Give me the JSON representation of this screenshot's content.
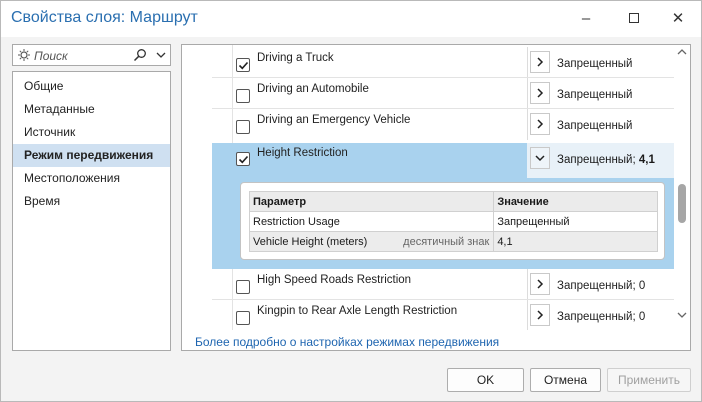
{
  "window": {
    "title": "Свойства слоя: Маршрут",
    "minimize": "–",
    "close": "✕"
  },
  "search": {
    "placeholder": "Поиск"
  },
  "sidebar": {
    "items": [
      {
        "label": "Общие",
        "active": false
      },
      {
        "label": "Метаданные",
        "active": false
      },
      {
        "label": "Источник",
        "active": false
      },
      {
        "label": "Режим передвижения",
        "active": true
      },
      {
        "label": "Местоположения",
        "active": false
      },
      {
        "label": "Время",
        "active": false
      }
    ]
  },
  "restrictions": {
    "rows": [
      {
        "name": "Driving a Truck",
        "checked": true,
        "value": "Запрещенный"
      },
      {
        "name": "Driving an Automobile",
        "checked": false,
        "value": "Запрещенный"
      },
      {
        "name": "Driving an Emergency Vehicle",
        "checked": false,
        "value": "Запрещенный"
      }
    ],
    "selected": {
      "name": "Height Restriction",
      "checked": true,
      "value": "Запрещенный;",
      "value_bold": "4,1"
    },
    "params_table": {
      "header_param": "Параметр",
      "header_value": "Значение",
      "rows": [
        {
          "param": "Restriction Usage",
          "type": "",
          "value": "Запрещенный"
        },
        {
          "param": "Vehicle Height (meters)",
          "type": "десятичный знак",
          "value": "4,1"
        }
      ]
    },
    "rows_after": [
      {
        "name": "High Speed Roads Restriction",
        "checked": false,
        "value": "Запрещенный; 0"
      },
      {
        "name": "Kingpin to Rear Axle Length Restriction",
        "checked": false,
        "value": "Запрещенный; 0"
      }
    ]
  },
  "footer": {
    "link": "Более подробно о настройках режимах передвижения"
  },
  "buttons": {
    "ok": "OK",
    "cancel": "Отмена",
    "apply": "Применить"
  },
  "colors": {
    "accent": "#2a6fb0",
    "selection": "#a9d2ee",
    "nav_active": "#cfe0f1",
    "link": "#1e65b0"
  }
}
